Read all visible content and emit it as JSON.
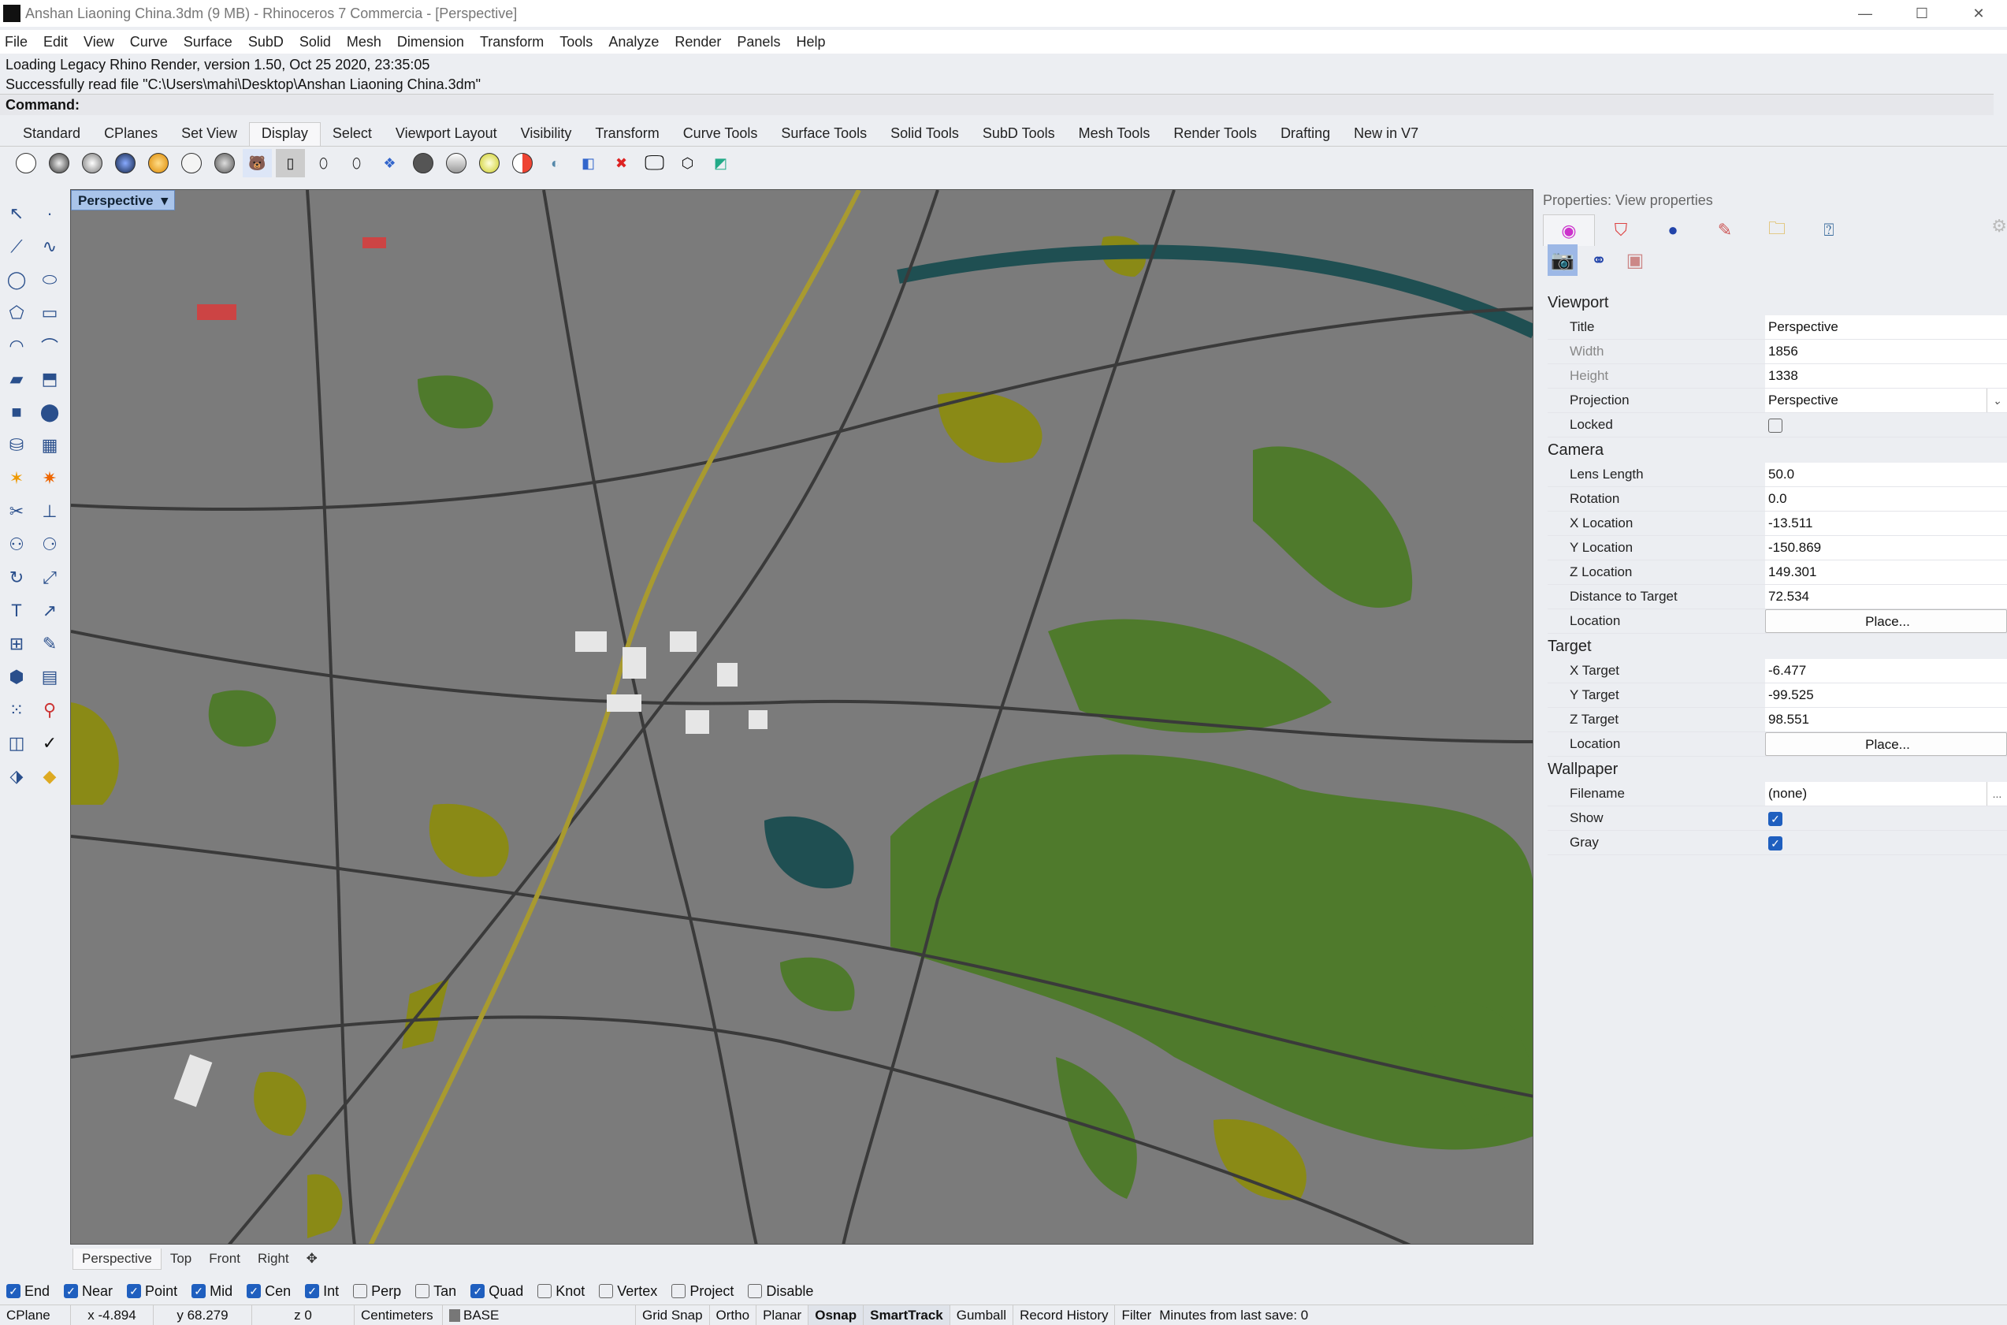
{
  "window": {
    "title": "Anshan Liaoning China.3dm (9 MB) - Rhinoceros 7 Commercia - [Perspective]",
    "controls": [
      "—",
      "☐",
      "✕"
    ]
  },
  "menu": [
    "File",
    "Edit",
    "View",
    "Curve",
    "Surface",
    "SubD",
    "Solid",
    "Mesh",
    "Dimension",
    "Transform",
    "Tools",
    "Analyze",
    "Render",
    "Panels",
    "Help"
  ],
  "command": {
    "history": [
      "Loading Legacy Rhino Render, version 1.50, Oct 25 2020, 23:35:05",
      "Successfully read file \"C:\\Users\\mahi\\Desktop\\Anshan Liaoning China.3dm\""
    ],
    "prompt": "Command:"
  },
  "toolbar_tabs": [
    "Standard",
    "CPlanes",
    "Set View",
    "Display",
    "Select",
    "Viewport Layout",
    "Visibility",
    "Transform",
    "Curve Tools",
    "Surface Tools",
    "Solid Tools",
    "SubD Tools",
    "Mesh Tools",
    "Render Tools",
    "Drafting",
    "New in V7"
  ],
  "active_toolbar_tab": "Display",
  "viewport": {
    "label": "Perspective",
    "tabs": [
      "Perspective",
      "Top",
      "Front",
      "Right"
    ],
    "colors": {
      "ground": "#7b7b7b",
      "forest": "#4f7a2c",
      "field": "#8a8a16",
      "water": "#1f4f52",
      "road": "#3a3a3a"
    }
  },
  "osnap": [
    {
      "label": "End",
      "checked": true
    },
    {
      "label": "Near",
      "checked": true
    },
    {
      "label": "Point",
      "checked": true
    },
    {
      "label": "Mid",
      "checked": true
    },
    {
      "label": "Cen",
      "checked": true
    },
    {
      "label": "Int",
      "checked": true
    },
    {
      "label": "Perp",
      "checked": false
    },
    {
      "label": "Tan",
      "checked": false
    },
    {
      "label": "Quad",
      "checked": true
    },
    {
      "label": "Knot",
      "checked": false
    },
    {
      "label": "Vertex",
      "checked": false
    },
    {
      "label": "Project",
      "checked": false
    },
    {
      "label": "Disable",
      "checked": false
    }
  ],
  "status": {
    "cplane": "CPlane",
    "x": "x -4.894",
    "y": "y 68.279",
    "z": "z 0",
    "units": "Centimeters",
    "layer": "BASE",
    "grid_snap": "Grid Snap",
    "ortho": "Ortho",
    "planar": "Planar",
    "osnap": "Osnap",
    "smarttrack": "SmartTrack",
    "gumball": "Gumball",
    "record_history": "Record History",
    "filter": "Filter",
    "minutes": "Minutes from last save: 0"
  },
  "panel": {
    "title": "Properties: View properties",
    "viewport": {
      "heading": "Viewport",
      "title_label": "Title",
      "title": "Perspective",
      "width_label": "Width",
      "width": "1856",
      "height_label": "Height",
      "height": "1338",
      "projection_label": "Projection",
      "projection": "Perspective",
      "locked_label": "Locked",
      "locked": false
    },
    "camera": {
      "heading": "Camera",
      "lens_label": "Lens Length",
      "lens": "50.0",
      "rotation_label": "Rotation",
      "rotation": "0.0",
      "xloc_label": "X Location",
      "xloc": "-13.511",
      "yloc_label": "Y Location",
      "yloc": "-150.869",
      "zloc_label": "Z Location",
      "zloc": "149.301",
      "dist_label": "Distance to Target",
      "dist": "72.534",
      "location_label": "Location",
      "place": "Place..."
    },
    "target": {
      "heading": "Target",
      "x_label": "X Target",
      "x": "-6.477",
      "y_label": "Y Target",
      "y": "-99.525",
      "z_label": "Z Target",
      "z": "98.551",
      "location_label": "Location",
      "place": "Place..."
    },
    "wallpaper": {
      "heading": "Wallpaper",
      "filename_label": "Filename",
      "filename": "(none)",
      "browse": "...",
      "show_label": "Show",
      "show": true,
      "gray_label": "Gray",
      "gray": true
    }
  }
}
